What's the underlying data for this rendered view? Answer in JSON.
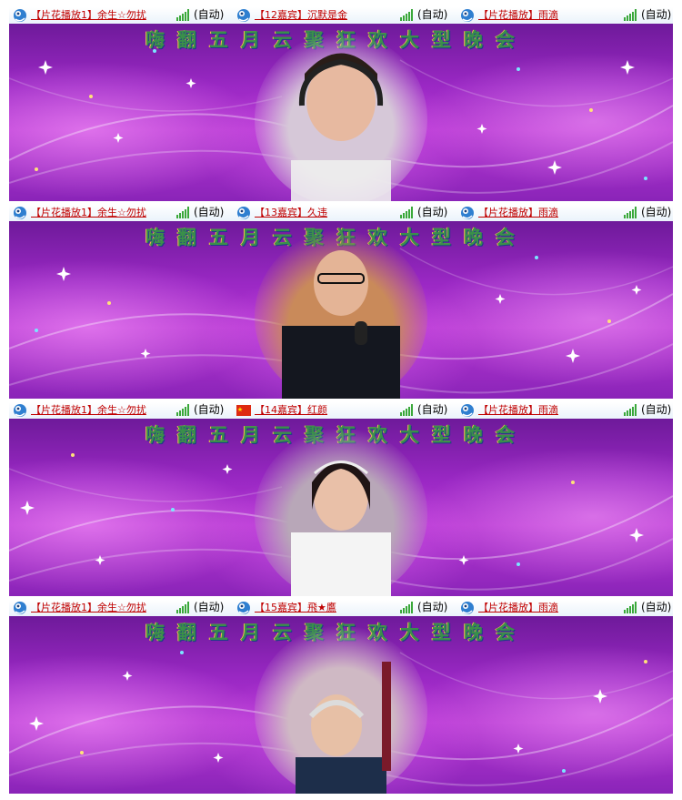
{
  "stage_title": "嗨翻五月云聚狂欢大型晚会",
  "colors": {
    "name_link": "#c00000",
    "bar_bg": "#eaf3fb",
    "stage_purple": "#9a28c4",
    "signal_green": "#3aa83a"
  },
  "panels": [
    {
      "left": {
        "name": "【片花播放1】余生☆勿扰",
        "mode": "(自动)",
        "icon": "blue-bird-icon"
      },
      "center": {
        "name": "【12嘉宾】沉默是金",
        "mode": "(自动)",
        "icon": "blue-bird-icon"
      },
      "right": {
        "name": "【片花播放】雨滴",
        "mode": "(自动)",
        "icon": "blue-bird-icon"
      }
    },
    {
      "left": {
        "name": "【片花播放1】余生☆勿扰",
        "mode": "(自动)",
        "icon": "blue-bird-icon"
      },
      "center": {
        "name": "【13嘉宾】久违",
        "mode": "(自动)",
        "icon": "blue-bird-icon"
      },
      "right": {
        "name": "【片花播放】雨滴",
        "mode": "(自动)",
        "icon": "blue-bird-icon"
      }
    },
    {
      "left": {
        "name": "【片花播放1】余生☆勿扰",
        "mode": "(自动)",
        "icon": "blue-bird-icon"
      },
      "center": {
        "name": "【14嘉宾】红颜",
        "mode": "(自动)",
        "icon": "china-flag-icon"
      },
      "right": {
        "name": "【片花播放】雨滴",
        "mode": "(自动)",
        "icon": "blue-bird-icon"
      }
    },
    {
      "left": {
        "name": "【片花播放1】余生☆勿扰",
        "mode": "(自动)",
        "icon": "blue-bird-icon"
      },
      "center": {
        "name": "【15嘉宾】飛★鷹",
        "mode": "(自动)",
        "icon": "blue-bird-icon"
      },
      "right": {
        "name": "【片花播放】雨滴",
        "mode": "(自动)",
        "icon": "blue-bird-icon"
      }
    }
  ]
}
